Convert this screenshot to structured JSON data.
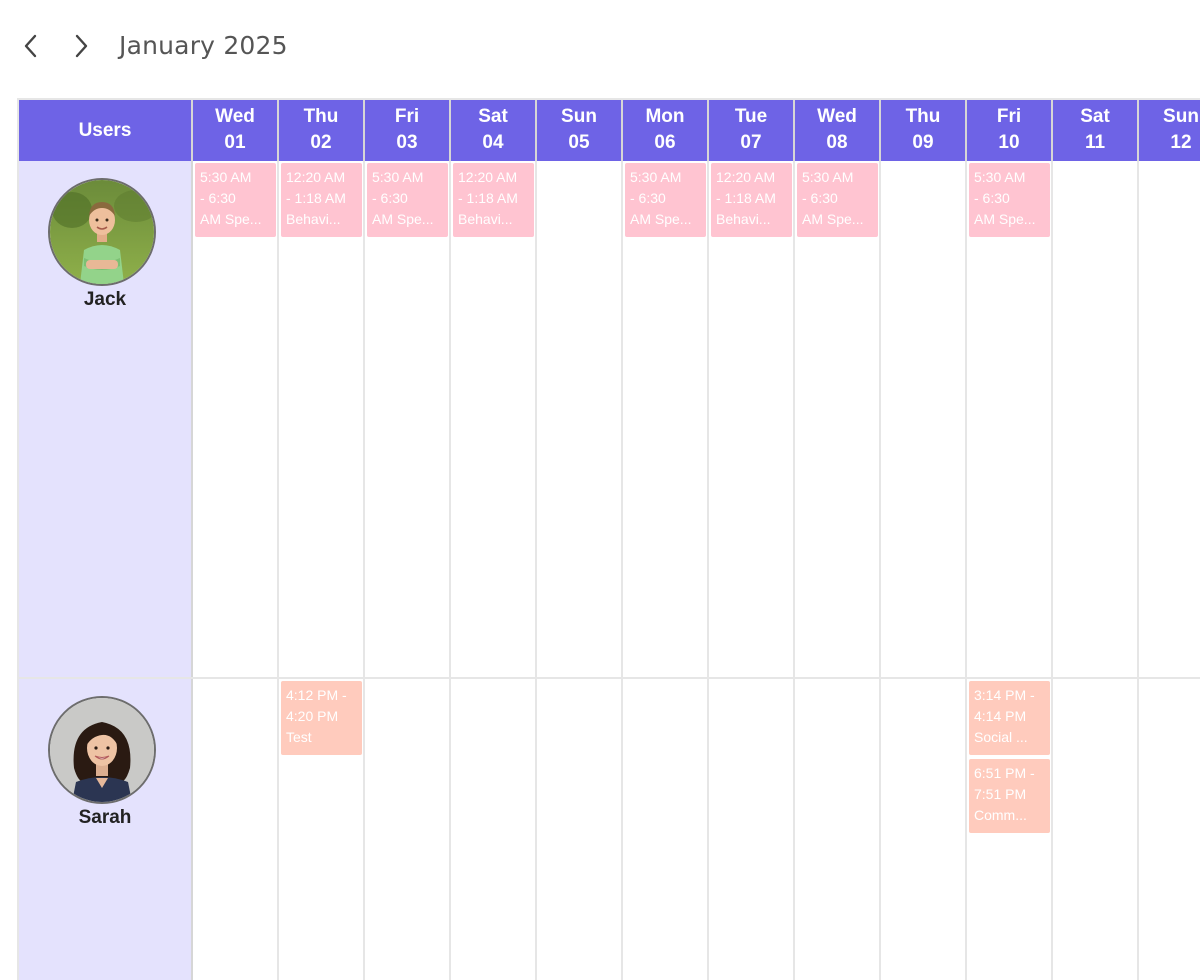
{
  "nav": {
    "prev_icon": "chevron-left-icon",
    "next_icon": "chevron-right-icon",
    "month_label": "January 2025"
  },
  "grid": {
    "users_header": "Users",
    "days": [
      {
        "name": "Wed",
        "num": "01"
      },
      {
        "name": "Thu",
        "num": "02"
      },
      {
        "name": "Fri",
        "num": "03"
      },
      {
        "name": "Sat",
        "num": "04"
      },
      {
        "name": "Sun",
        "num": "05"
      },
      {
        "name": "Mon",
        "num": "06"
      },
      {
        "name": "Tue",
        "num": "07"
      },
      {
        "name": "Wed",
        "num": "08"
      },
      {
        "name": "Thu",
        "num": "09"
      },
      {
        "name": "Fri",
        "num": "10"
      },
      {
        "name": "Sat",
        "num": "11"
      },
      {
        "name": "Sun",
        "num": "12"
      }
    ]
  },
  "colors": {
    "header_bg": "#6e63e6",
    "user_cell_bg": "#e4e2fd",
    "event_pink": "#ffc4d1",
    "event_peach": "#ffcbbd"
  },
  "users": [
    {
      "name": "Jack",
      "avatar_icon": "boy-avatar-icon",
      "events": [
        {
          "day": 0,
          "lines": [
            "5:30 AM",
            "- 6:30",
            "AM Spe..."
          ],
          "color": "pink"
        },
        {
          "day": 1,
          "lines": [
            "12:20 AM",
            "- 1:18 AM",
            "Behavi..."
          ],
          "color": "pink"
        },
        {
          "day": 2,
          "lines": [
            "5:30 AM",
            "- 6:30",
            "AM Spe..."
          ],
          "color": "pink"
        },
        {
          "day": 3,
          "lines": [
            "12:20 AM",
            "- 1:18 AM",
            "Behavi..."
          ],
          "color": "pink"
        },
        {
          "day": 5,
          "lines": [
            "5:30 AM",
            "- 6:30",
            "AM Spe..."
          ],
          "color": "pink"
        },
        {
          "day": 6,
          "lines": [
            "12:20 AM",
            "- 1:18 AM",
            "Behavi..."
          ],
          "color": "pink"
        },
        {
          "day": 7,
          "lines": [
            "5:30 AM",
            "- 6:30",
            "AM Spe..."
          ],
          "color": "pink"
        },
        {
          "day": 9,
          "lines": [
            "5:30 AM",
            "- 6:30",
            "AM Spe..."
          ],
          "color": "pink"
        }
      ]
    },
    {
      "name": "Sarah",
      "avatar_icon": "woman-avatar-icon",
      "events": [
        {
          "day": 1,
          "lines": [
            "4:12 PM -",
            "4:20 PM",
            "Test"
          ],
          "color": "peach"
        },
        {
          "day": 9,
          "lines": [
            "3:14 PM -",
            "4:14 PM",
            "Social ..."
          ],
          "color": "peach"
        },
        {
          "day": 9,
          "lines": [
            "6:51 PM -",
            "7:51 PM",
            "Comm..."
          ],
          "color": "peach"
        }
      ]
    }
  ]
}
